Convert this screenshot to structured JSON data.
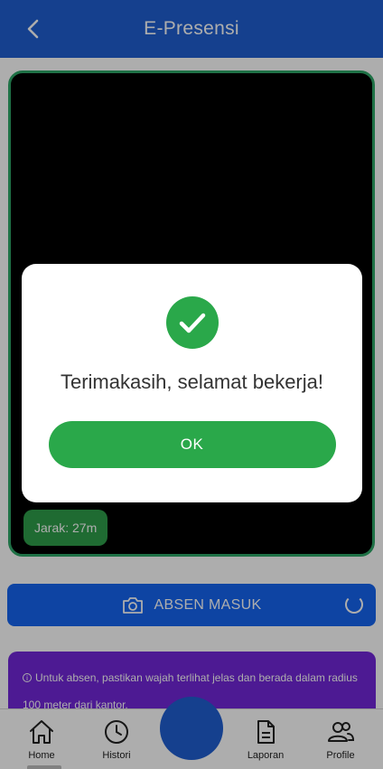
{
  "appbar": {
    "title": "E-Presensi",
    "back_icon": "chevron-left-icon"
  },
  "camera": {
    "distance_label": "Jarak: 27m"
  },
  "absen_button": {
    "label": "ABSEN MASUK",
    "icon": "camera-icon"
  },
  "info": {
    "text": "Untuk absen, pastikan wajah terlihat jelas dan berada dalam radius 100 meter dari kantor."
  },
  "nav": {
    "items": [
      {
        "label": "Home",
        "icon": "home-icon"
      },
      {
        "label": "Histori",
        "icon": "clock-icon"
      },
      {
        "label": "Laporan",
        "icon": "document-icon"
      },
      {
        "label": "Profile",
        "icon": "users-icon"
      }
    ]
  },
  "dialog": {
    "message": "Terimakasih, selamat bekerja!",
    "ok_label": "OK",
    "icon": "check-circle-icon"
  },
  "colors": {
    "primary": "#1f5fd1",
    "success": "#2aa84a",
    "info": "#7227d9",
    "card_border": "#2fa768"
  }
}
